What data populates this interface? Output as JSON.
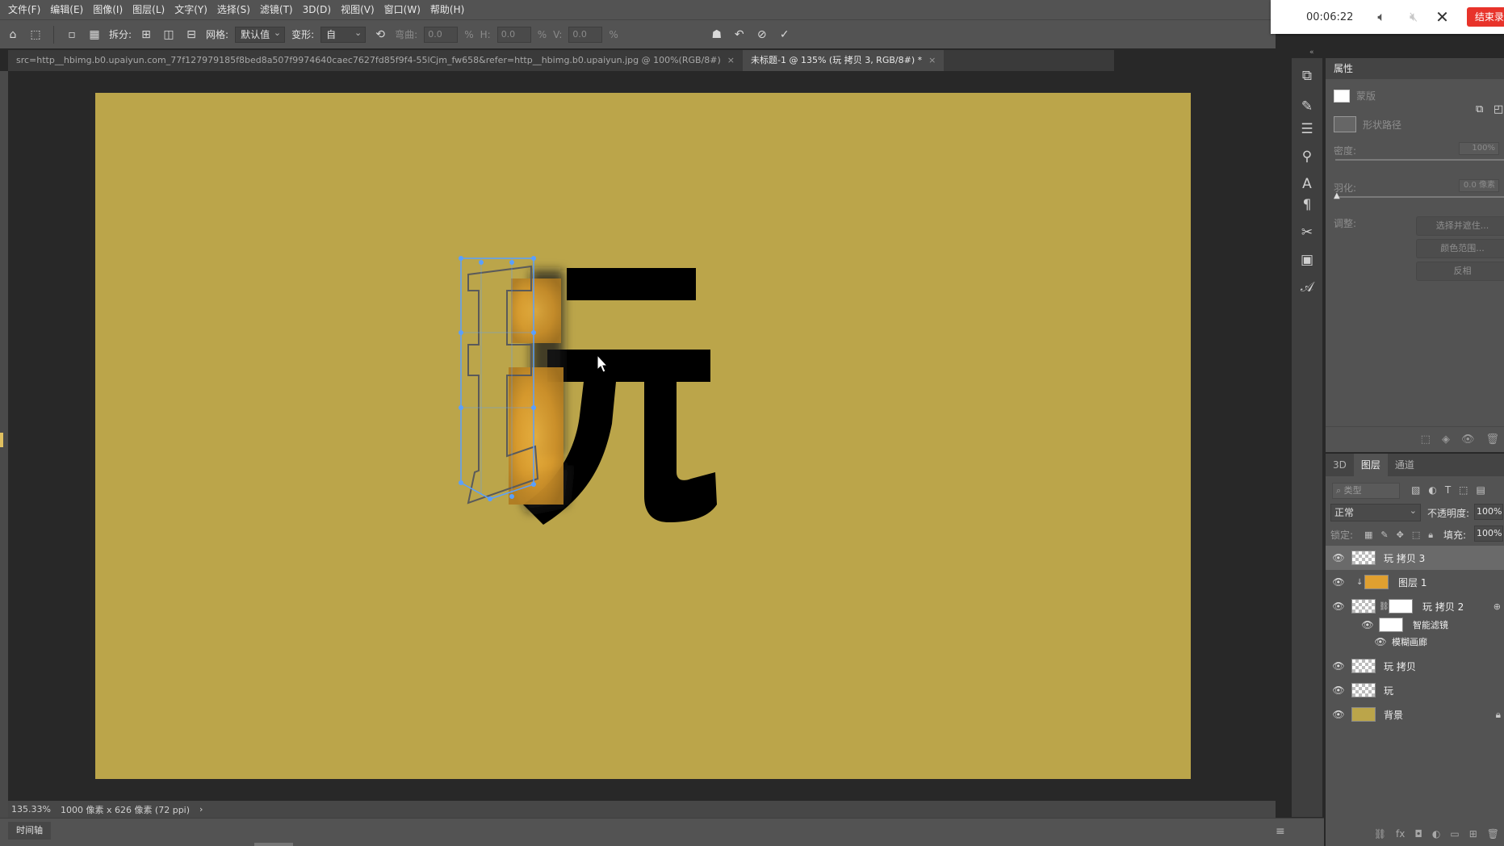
{
  "menu": [
    "文件(F)",
    "编辑(E)",
    "图像(I)",
    "图层(L)",
    "文字(Y)",
    "选择(S)",
    "滤镜(T)",
    "3D(D)",
    "视图(V)",
    "窗口(W)",
    "帮助(H)"
  ],
  "options": {
    "split_label": "拆分:",
    "grid_label": "网格:",
    "grid_value": "默认值",
    "warp_label": "变形:",
    "warp_value": "自",
    "bend_label": "弯曲:",
    "bend_value": "0.0",
    "h_label": "H:",
    "h_value": "0.0",
    "v_label": "V:",
    "v_value": "0.0",
    "pct": "%"
  },
  "recorder": {
    "time": "00:06:22",
    "stop_label": "结束录制"
  },
  "tabs": [
    {
      "label": "src=http__hbimg.b0.upaiyun.com_77f127979185f8bed8a507f9974640caec7627fd85f9f4-55lCjm_fw658&refer=http__hbimg.b0.upaiyun.jpg @ 100%(RGB/8#)",
      "close": "×"
    },
    {
      "label": "未标题-1 @ 135% (玩 拷贝 3, RGB/8#) *",
      "close": "×"
    }
  ],
  "canvas": {
    "background": "#bba54a",
    "glyph": "玩"
  },
  "status": {
    "zoom": "135.33%",
    "doc_info": "1000 像素 x 626 像素 (72 ppi)",
    "arrow": "›"
  },
  "timeline_tab": "时间轴",
  "properties": {
    "title": "属性",
    "mask_label": "蒙版",
    "vector_label": "形状路径",
    "density_label": "密度:",
    "density_value": "100%",
    "feather_label": "羽化:",
    "feather_value": "0.0 像素",
    "adjust_label": "调整:",
    "btn_select_mask": "选择并遮住...",
    "btn_color_range": "颜色范围...",
    "btn_invert": "反相"
  },
  "layers": {
    "tabs": [
      "3D",
      "图层",
      "通道"
    ],
    "filter_placeholder": "类型",
    "blend_mode": "正常",
    "opacity_label": "不透明度:",
    "opacity_value": "100%",
    "lock_label": "锁定:",
    "fill_label": "填充:",
    "fill_value": "100%",
    "items": [
      {
        "name": "玩 拷贝 3"
      },
      {
        "name": "图层 1"
      },
      {
        "name": "玩 拷贝 2"
      },
      {
        "name": "智能滤镜"
      },
      {
        "name": "模糊画廊"
      },
      {
        "name": "玩 拷贝"
      },
      {
        "name": "玩"
      },
      {
        "name": "背景"
      }
    ]
  },
  "colors": {
    "canvas": "#bba54a",
    "gold": "#e0a030",
    "selection": "#5aa0ff",
    "record_button": "#e8332a"
  }
}
